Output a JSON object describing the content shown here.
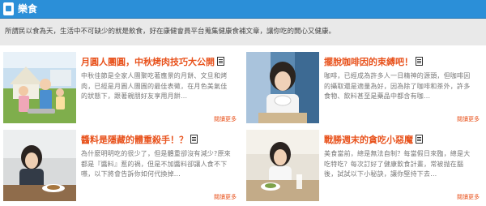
{
  "header": {
    "title": "樂食"
  },
  "intro": {
    "text": "所謂民以食為天，生活中不可缺少的就是飲食，好在康健會員平台蒐集健康食補文章，讓你吃的開心又健康。"
  },
  "articles": [
    {
      "title": "月圓人團圓，中秋烤肉技巧大公開",
      "excerpt": "中秋佳節是全家人團聚吃著應景的月餅、文旦和烤肉，已經是月圓人團圓的最佳表徵，在月色美氣佳的狀態下，跟著親朋好友享用月餅...",
      "read_more": "閱讀更多"
    },
    {
      "title": "擺脫咖啡因的束縛吧！",
      "excerpt": "咖啡，已經成為許多人一日精神的源頭，但咖啡因的攝取還是適量為好，因為除了咖啡和茶外，許多食物、飲料甚至是藥品中都含有咖...",
      "read_more": "閱讀更多"
    },
    {
      "title": "醬料是隱藏的體重殺手！？",
      "excerpt": "為什麼明明吃的很少了，但是體重卻沒有減少?原來都是『醬料』惹的禍，但是不加醬料卻讓人食不下嚥，以下將會告訴你如何代換掉...",
      "read_more": "閱讀更多"
    },
    {
      "title": "戰勝週末的貪吃小惡魔",
      "excerpt": "美食當前，總是無法自制？每當假日來臨，總是大吃特吃？每次訂好了健康飲食計畫，常被抛在腦後，試試以下小秘訣，讓你堅持下去...",
      "read_more": "閱讀更多"
    }
  ],
  "colors": {
    "header_bg": "#2b8fd8",
    "intro_bg": "#e9e9e9",
    "title_accent": "#e8521c"
  },
  "icons": {
    "section": "section-square-icon",
    "title": "document-icon"
  }
}
